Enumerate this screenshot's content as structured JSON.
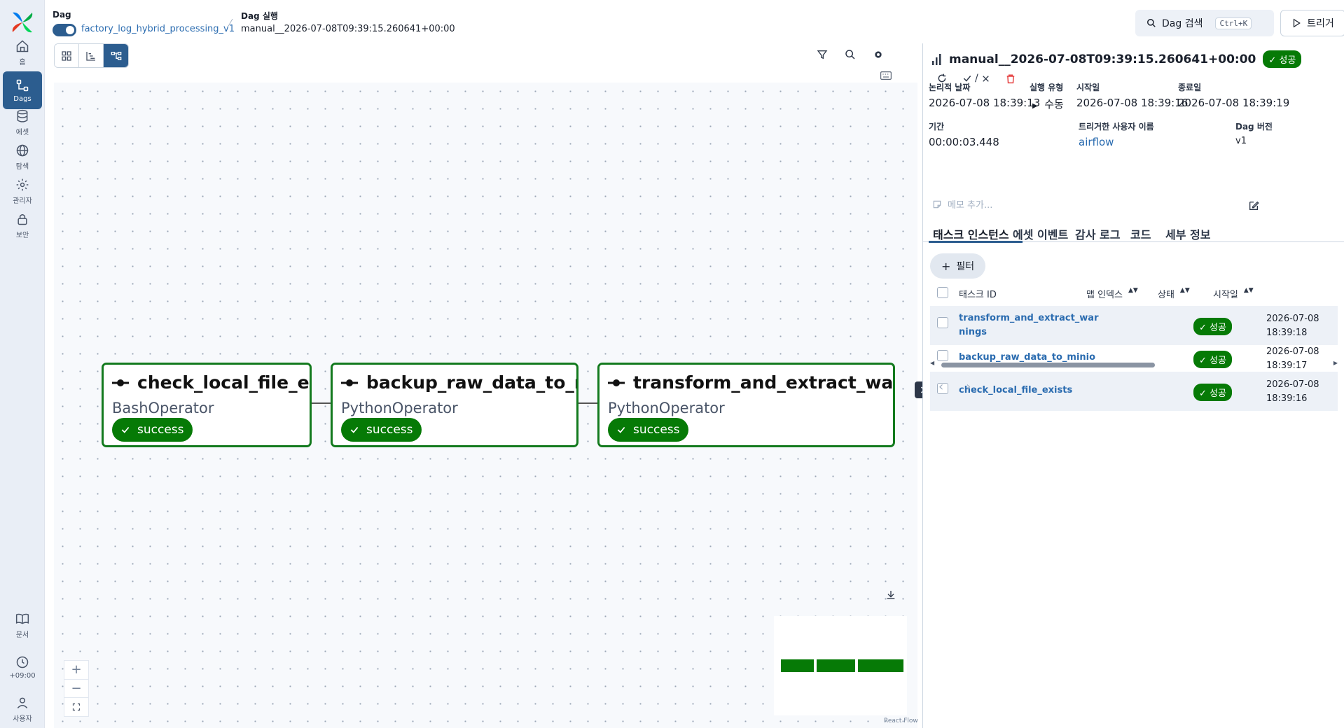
{
  "nav": {
    "items": [
      {
        "label": "홈",
        "icon": "home-icon"
      },
      {
        "label": "Dags",
        "icon": "dags-icon"
      },
      {
        "label": "에셋",
        "icon": "database-icon"
      },
      {
        "label": "탐색",
        "icon": "globe-icon"
      },
      {
        "label": "관리자",
        "icon": "gear-icon"
      },
      {
        "label": "보안",
        "icon": "lock-icon"
      }
    ],
    "bottom": [
      {
        "label": "문서",
        "icon": "book-icon"
      },
      {
        "label": "+09:00",
        "icon": "clock-icon"
      },
      {
        "label": "사용자",
        "icon": "user-icon"
      }
    ]
  },
  "header": {
    "dag_label": "Dag",
    "dag_name": "factory_log_hybrid_processing_v1",
    "run_label": "Dag 실행",
    "run_name": "manual__2026-07-08T09:39:15.260641+00:00",
    "search_placeholder": "Dag 검색",
    "search_shortcut": "Ctrl+K",
    "trigger_label": "트리거"
  },
  "graph": {
    "nodes": [
      {
        "title": "check_local_file_exists",
        "operator": "BashOperator",
        "status": "success"
      },
      {
        "title": "backup_raw_data_to_minio",
        "operator": "PythonOperator",
        "status": "success"
      },
      {
        "title": "transform_and_extract_warnings",
        "operator": "PythonOperator",
        "status": "success"
      }
    ],
    "attribution": "React Flow",
    "accent": "#067a06"
  },
  "panel": {
    "title": "manual__2026-07-08T09:39:15.260641+00:00",
    "status_badge": "성공",
    "mark_label": "/",
    "meta": {
      "logical_date_label": "논리적 날짜",
      "logical_date": "2026-07-08 18:39:13",
      "run_type_label": "실행 유형",
      "run_type": "수동",
      "start_label": "시작일",
      "start": "2026-07-08 18:39:16",
      "end_label": "종료일",
      "end": "2026-07-08 18:39:19",
      "duration_label": "기간",
      "duration": "00:00:03.448",
      "triggered_by_label": "트리거한 사용자 이름",
      "triggered_by": "airflow",
      "version_label": "Dag 버전",
      "version": "v1"
    },
    "memo_placeholder": "메모 추가...",
    "tabs": [
      "태스크 인스턴스",
      "에셋 이벤트",
      "감사 로그",
      "코드",
      "세부 정보"
    ],
    "filter_label": "필터",
    "columns": [
      "태스크 ID",
      "맵 인덱스",
      "상태",
      "시작일"
    ],
    "rows": [
      {
        "task_id": "transform_and_extract_warnings",
        "status": "성공",
        "start_date": "2026-07-08",
        "start_time": "18:39:18"
      },
      {
        "task_id": "backup_raw_data_to_minio",
        "status": "성공",
        "start_date": "2026-07-08",
        "start_time": "18:39:17"
      },
      {
        "task_id": "check_local_file_exists",
        "status": "성공",
        "start_date": "2026-07-08",
        "start_time": "18:39:16"
      }
    ]
  }
}
